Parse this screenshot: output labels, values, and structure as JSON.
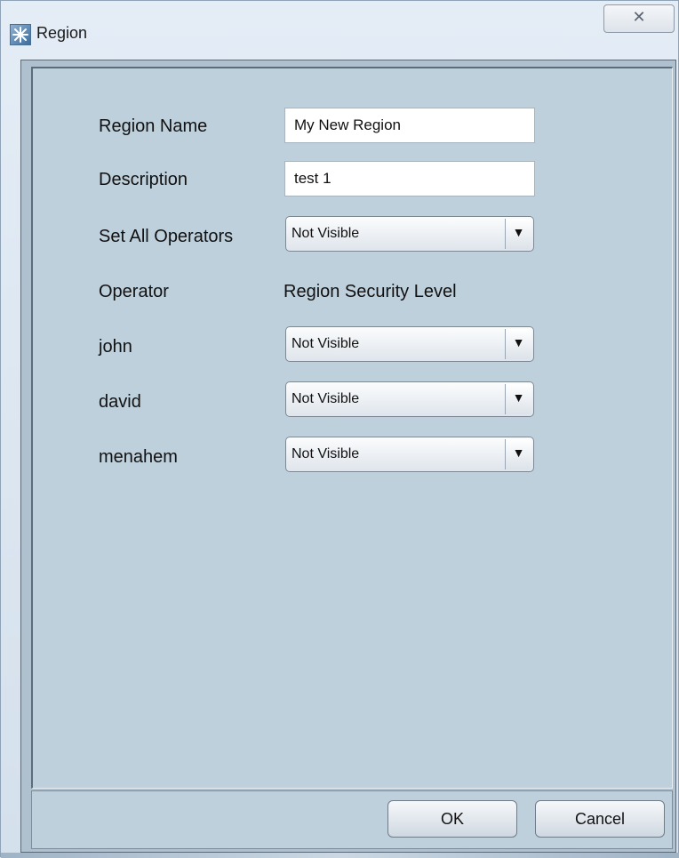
{
  "window": {
    "title": "Region",
    "icon": "region-app-icon",
    "close_glyph": "✕"
  },
  "form": {
    "region_name": {
      "label": "Region Name",
      "value": "My New Region"
    },
    "description": {
      "label": "Description",
      "value": "test 1"
    },
    "set_all_operators": {
      "label": "Set All Operators",
      "value": "Not Visible"
    }
  },
  "table": {
    "headers": {
      "operator": "Operator",
      "security_level": "Region Security Level"
    },
    "rows": [
      {
        "operator": "john",
        "level": "Not Visible"
      },
      {
        "operator": "david",
        "level": "Not Visible"
      },
      {
        "operator": "menahem",
        "level": "Not Visible"
      }
    ]
  },
  "dropdown_arrow": "▼",
  "buttons": {
    "ok": "OK",
    "cancel": "Cancel"
  }
}
